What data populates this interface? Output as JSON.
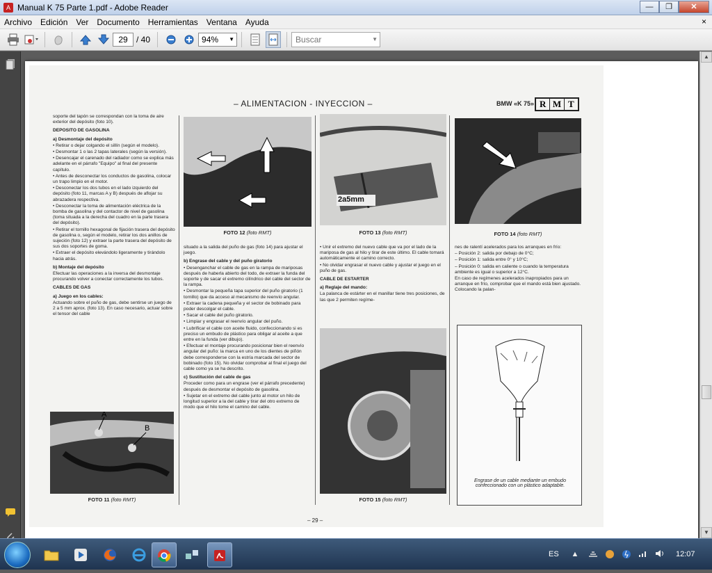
{
  "window": {
    "title": "Manual K 75 Parte 1.pdf - Adobe Reader",
    "min": "—",
    "max": "❐",
    "close": "✕"
  },
  "menu": [
    "Archivo",
    "Edición",
    "Ver",
    "Documento",
    "Herramientas",
    "Ventana",
    "Ayuda"
  ],
  "menu_close": "×",
  "toolbar": {
    "page_current": "29",
    "page_total": "/ 40",
    "zoom": "94%",
    "search_placeholder": "Buscar"
  },
  "doc": {
    "header_title": "– ALIMENTACION - INYECCION –",
    "header_right": "BMW «K 75»",
    "logo": [
      "R",
      "M",
      "T"
    ],
    "col1": {
      "p0": "soporte del tapón se correspondan con la toma de aire exterior del depósito (foto 10).",
      "h1": "DEPOSITO DE GASOLINA",
      "h1a": "a) Desmontaje del depósito",
      "items": [
        "• Retirar o dejar colgando el sillín (según el modelo).",
        "• Desmontar 1 o las 2 tapas laterales (según la versión).",
        "• Desencajar el carenado del radiador como se explica más adelante en el párrafo \"Equipo\" al final del presente capítulo.",
        "• Antes de desconectar los conductos de gasolina, colocar un trapo limpio en el motor.",
        "• Desconectar los dos tubos en el lado izquierdo del depósito (foto 11, marcas A y B) después de aflojar su abrazadera respectiva.",
        "• Desconectar la toma de alimentación eléctrica de la bomba de gasolina y del contactor de nivel de gasolina (toma situada a la derecha del cuadro en la parte trasera del depósito).",
        "• Retirar el tornillo hexagonal de fijación trasera del depósito de gasolina o, según el modelo, retirar los dos anillos de sujeción (foto 12) y extraer la parte trasera del depósito de sus dos soportes de goma.",
        "• Extraer el depósito elevándolo ligeramente y tirándolo hacia atrás."
      ],
      "h1b": "b) Montaje del depósito",
      "p1": "Efectuar las operaciones a la inversa del desmontaje procurando volver a conectar correctamente los tubos.",
      "h2": "CABLES DE GAS",
      "h2a": "a) Juego en los cables:",
      "p2": "Actuando sobre el puño de gas, debe sentirse un juego de 2 a 5 mm aprox. (foto 13). En caso necesario, actuar sobre el tensor del cable",
      "label_a": "A",
      "label_b": "B",
      "cap11": "FOTO 11",
      "cap11_src": "(foto RMT)"
    },
    "col2": {
      "cap12": "FOTO 12",
      "cap12_src": "(foto RMT)",
      "p0": "situado a la salida del puño de gas (foto 14) para ajustar el juego.",
      "h1": "b) Engrase del cable y del puño giratorio",
      "items": [
        "• Desenganchar el cable de gas en la rampa de mariposas después de haberla abierto del todo, de extraer la funda del soporte y de sacar el extremo cilíndrico del cable del sector de la rampa.",
        "• Desmontar la pequeña tapa superior del puño giratorio (1 tornillo) que da acceso al mecanismo de reenvío angular.",
        "• Extraer la cadena pequeña y el sector de bobinado para poder descolgar el cable.",
        "• Sacar el cable del puño giratorio.",
        "• Limpiar y engrasar el reenvío angular del puño.",
        "• Lubrificar el cable con aceite fluido, confeccionando si es preciso un embudo de plástico para obligar al aceite a que entre en la funda (ver dibujo).",
        "• Efectuar el montaje procurando posicionar bien el reenvío angular del puño: la marca en uno de los dientes de piñón debe corresponderse con la estría marcada del sector de bobinado (foto 15). No olvidar comprobar al final el juego del cable como ya se ha descrito."
      ],
      "h2": "c) Sustitución del cable de gas",
      "p2": "Proceder como para un engrase (ver el párrafo precedente) después de desmontar el depósito de gasolina.",
      "p3": "• Sujetar en el extremo del cable junto al motor un hilo de longitud superior a la del cable y tirar del otro extremo de modo que el hilo tome el camino del cable."
    },
    "col3": {
      "photo_label": "2a5mm",
      "cap13": "FOTO 13",
      "cap13_src": "(foto RMT)",
      "items": [
        "• Unir el extremo del nuevo cable que va por el lado de la mariposa de gas al hilo y tirar de este último. El cable tomará automáticamente el camino correcto.",
        "• No olvidar engrasar el nuevo cable y ajustar el juego en el puño de gas."
      ],
      "h1": "CABLE DE ESTARTER",
      "h1a": "a) Reglaje del mando:",
      "p1": "La palanca de estárter en el manillar tiene tres posiciones, de las que 2 permiten regíme-",
      "cap15": "FOTO 15",
      "cap15_src": "(foto RMT)"
    },
    "col4": {
      "cap14": "FOTO 14",
      "cap14_src": "(foto RMT)",
      "p0": "nes de ralentí acelerados para los arranques en frío:",
      "items": [
        "– Posición 2: salida por debajo de 0°C;",
        "– Posición 1: salida entre 0° y 10°C;",
        "– Posición 0: salida en caliente o cuando la temperatura ambiente es igual o superior a 12°C."
      ],
      "p1": "En caso de regímenes acelerados inapropiados para un arranque en frío, comprobar que el mando está bien ajustado. Colocando la palan-",
      "diagram_caption": "Engrase de un cable mediante un embudo confeccionado con un plástico adaptable."
    },
    "page_number": "– 29 –"
  },
  "tray": {
    "lang": "ES",
    "time": "12:07"
  }
}
